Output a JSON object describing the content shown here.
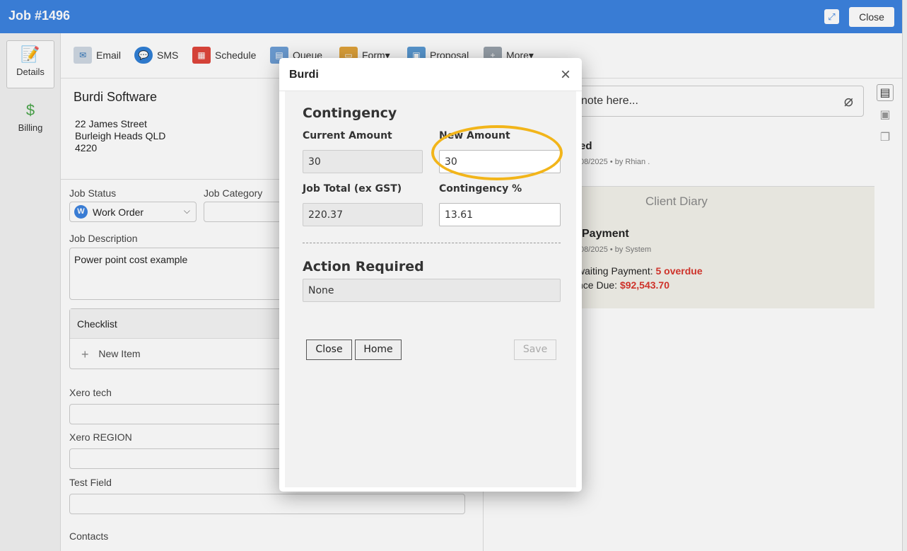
{
  "window": {
    "title": "Job #1496",
    "close_label": "Close"
  },
  "rail": [
    {
      "label": "Details",
      "icon": "details-icon"
    },
    {
      "label": "Billing",
      "icon": "billing-icon"
    }
  ],
  "toolbar": {
    "email": "Email",
    "sms": "SMS",
    "schedule": "Schedule",
    "queue": "Queue",
    "form": "Form▾",
    "proposal": "Proposal",
    "more": "More▾"
  },
  "client": {
    "name": "Burdi Software",
    "address": [
      "22 James Street",
      "Burleigh Heads QLD",
      "4220"
    ]
  },
  "fields": {
    "job_status_label": "Job Status",
    "job_status_value": "Work Order",
    "job_status_badge": "W",
    "job_category_label": "Job Category",
    "job_description_label": "Job Description",
    "job_description_value": "Power point cost example",
    "checklist_label": "Checklist",
    "new_item_label": "New Item",
    "xero_tech_label": "Xero tech",
    "xero_region_label": "Xero REGION",
    "test_field_label": "Test Field",
    "contacts_label": "Contacts"
  },
  "notes": {
    "placeholder": "note here...",
    "activity_title": "ed",
    "activity_meta": "08/2025 •  by Rhian ."
  },
  "diary": {
    "title": "Client Diary",
    "payment_title": "Payment",
    "payment_meta": "/08/2025 •  by System",
    "line1_prefix": "waiting Payment: ",
    "line1_value": "5 overdue",
    "line2_prefix": "nce Due: ",
    "line2_value": "$92,543.70"
  },
  "modal": {
    "title": "Burdi",
    "contingency_heading": "Contingency",
    "current_amount_label": "Current Amount",
    "current_amount": "30",
    "new_amount_label": "New Amount",
    "new_amount": "30",
    "job_total_label": "Job Total (ex GST)",
    "job_total": "220.37",
    "contingency_pct_label": "Contingency %",
    "contingency_pct": "13.61",
    "action_heading": "Action Required",
    "action_value": "None",
    "close_btn": "Close",
    "home_btn": "Home",
    "save_btn": "Save"
  },
  "colors": {
    "brand": "#3b82e0",
    "highlight": "#f2b51a",
    "alert": "#d9342b"
  }
}
